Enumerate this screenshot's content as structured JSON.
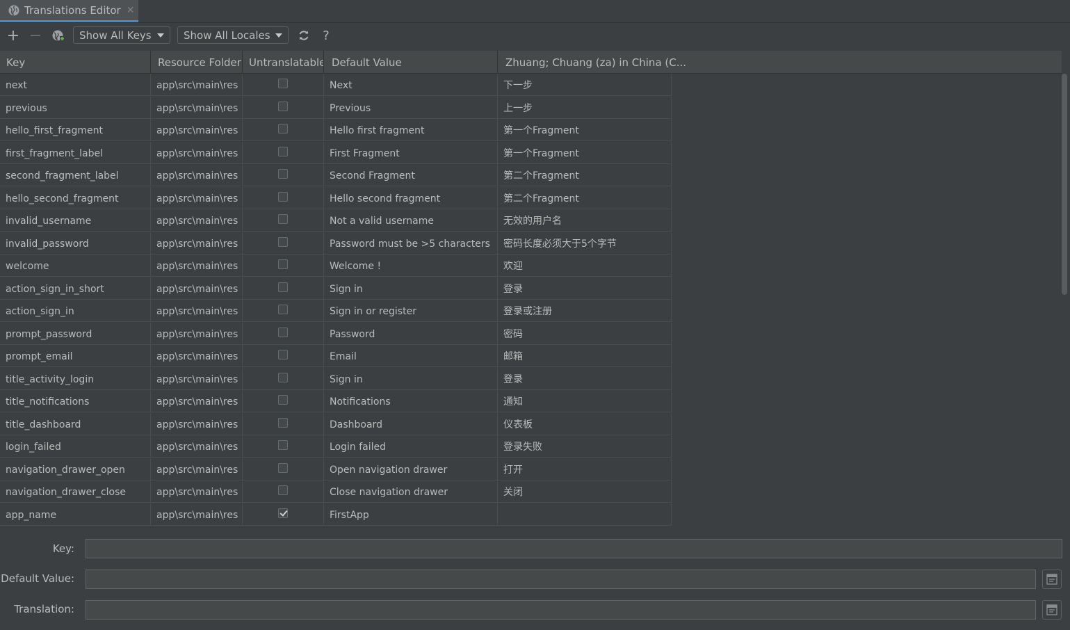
{
  "tab": {
    "title": "Translations Editor",
    "close": "✕"
  },
  "toolbar": {
    "add": "+",
    "remove": "−",
    "keys_filter": "Show All Keys",
    "locales_filter": "Show All Locales",
    "help": "?"
  },
  "columns": [
    "Key",
    "Resource Folder",
    "Untranslatable",
    "Default Value",
    "Zhuang; Chuang (za) in China (C..."
  ],
  "rows": [
    {
      "key": "next",
      "folder": "app\\src\\main\\res",
      "untranslatable": false,
      "default": "Next",
      "translation": "下一步"
    },
    {
      "key": "previous",
      "folder": "app\\src\\main\\res",
      "untranslatable": false,
      "default": "Previous",
      "translation": "上一步"
    },
    {
      "key": "hello_first_fragment",
      "folder": "app\\src\\main\\res",
      "untranslatable": false,
      "default": "Hello first fragment",
      "translation": "第一个Fragment"
    },
    {
      "key": "first_fragment_label",
      "folder": "app\\src\\main\\res",
      "untranslatable": false,
      "default": "First Fragment",
      "translation": "第一个Fragment"
    },
    {
      "key": "second_fragment_label",
      "folder": "app\\src\\main\\res",
      "untranslatable": false,
      "default": "Second Fragment",
      "translation": "第二个Fragment"
    },
    {
      "key": "hello_second_fragment",
      "folder": "app\\src\\main\\res",
      "untranslatable": false,
      "default": "Hello second fragment",
      "translation": "第二个Fragment"
    },
    {
      "key": "invalid_username",
      "folder": "app\\src\\main\\res",
      "untranslatable": false,
      "default": "Not a valid username",
      "translation": "无效的用户名"
    },
    {
      "key": "invalid_password",
      "folder": "app\\src\\main\\res",
      "untranslatable": false,
      "default": "Password must be >5 characters",
      "translation": "密码长度必须大于5个字节"
    },
    {
      "key": "welcome",
      "folder": "app\\src\\main\\res",
      "untranslatable": false,
      "default": "Welcome !",
      "translation": "欢迎"
    },
    {
      "key": "action_sign_in_short",
      "folder": "app\\src\\main\\res",
      "untranslatable": false,
      "default": "Sign in",
      "translation": "登录"
    },
    {
      "key": "action_sign_in",
      "folder": "app\\src\\main\\res",
      "untranslatable": false,
      "default": "Sign in or register",
      "translation": "登录或注册"
    },
    {
      "key": "prompt_password",
      "folder": "app\\src\\main\\res",
      "untranslatable": false,
      "default": "Password",
      "translation": "密码"
    },
    {
      "key": "prompt_email",
      "folder": "app\\src\\main\\res",
      "untranslatable": false,
      "default": "Email",
      "translation": "邮箱"
    },
    {
      "key": "title_activity_login",
      "folder": "app\\src\\main\\res",
      "untranslatable": false,
      "default": "Sign in",
      "translation": "登录"
    },
    {
      "key": "title_notifications",
      "folder": "app\\src\\main\\res",
      "untranslatable": false,
      "default": "Notifications",
      "translation": "通知"
    },
    {
      "key": "title_dashboard",
      "folder": "app\\src\\main\\res",
      "untranslatable": false,
      "default": "Dashboard",
      "translation": "仪表板"
    },
    {
      "key": "login_failed",
      "folder": "app\\src\\main\\res",
      "untranslatable": false,
      "default": "Login failed",
      "translation": "登录失败"
    },
    {
      "key": "navigation_drawer_open",
      "folder": "app\\src\\main\\res",
      "untranslatable": false,
      "default": "Open navigation drawer",
      "translation": "打开"
    },
    {
      "key": "navigation_drawer_close",
      "folder": "app\\src\\main\\res",
      "untranslatable": false,
      "default": "Close navigation drawer",
      "translation": "关闭"
    },
    {
      "key": "app_name",
      "folder": "app\\src\\main\\res",
      "untranslatable": true,
      "default": "FirstApp",
      "translation": ""
    }
  ],
  "form": {
    "key_label": "Key:",
    "default_label": "Default Value:",
    "translation_label": "Translation:",
    "key_value": "",
    "default_value": "",
    "translation_value": ""
  },
  "colors": {
    "background": "#3c3f41",
    "header": "#45494a",
    "text": "#bbbbbb",
    "tab_accent": "#4a88c7"
  }
}
